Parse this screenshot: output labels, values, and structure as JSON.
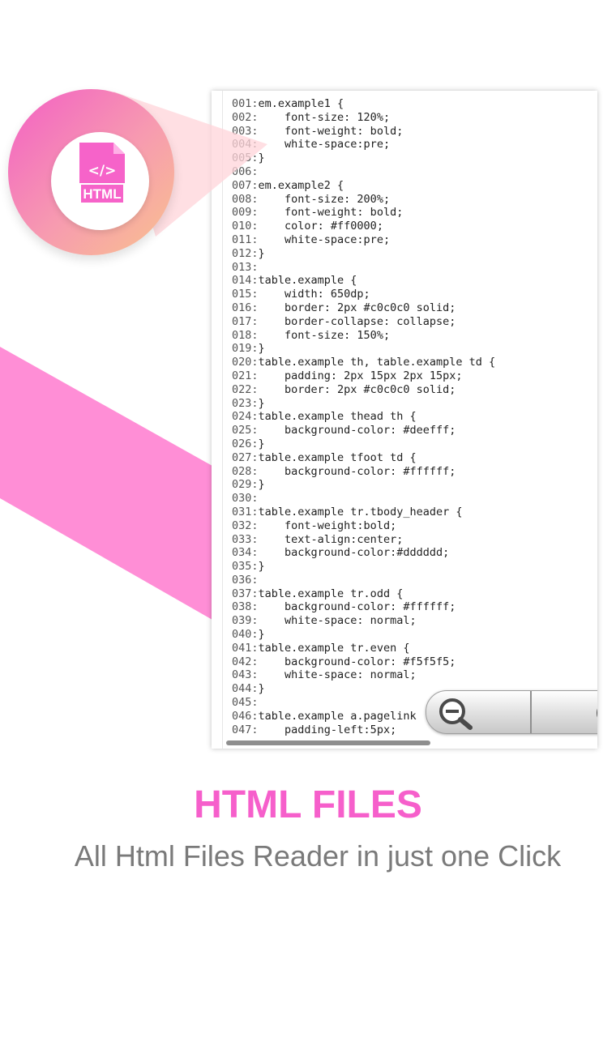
{
  "colors": {
    "accent_pink": "#f65fcb",
    "stripe_pink": "#ff8ed6",
    "subtitle_gray": "#7a7a7a"
  },
  "badge": {
    "icon": "html-file-icon",
    "code_glyph": "</>",
    "label": "HTML"
  },
  "code_lines": [
    {
      "num": "001:",
      "text": "em.example1 {"
    },
    {
      "num": "002:",
      "text": "    font-size: 120%;"
    },
    {
      "num": "003:",
      "text": "    font-weight: bold;"
    },
    {
      "num": "004:",
      "text": "    white-space:pre;"
    },
    {
      "num": "005:",
      "text": "}"
    },
    {
      "num": "006:",
      "text": ""
    },
    {
      "num": "007:",
      "text": "em.example2 {"
    },
    {
      "num": "008:",
      "text": "    font-size: 200%;"
    },
    {
      "num": "009:",
      "text": "    font-weight: bold;"
    },
    {
      "num": "010:",
      "text": "    color: #ff0000;"
    },
    {
      "num": "011:",
      "text": "    white-space:pre;"
    },
    {
      "num": "012:",
      "text": "}"
    },
    {
      "num": "013:",
      "text": ""
    },
    {
      "num": "014:",
      "text": "table.example {"
    },
    {
      "num": "015:",
      "text": "    width: 650dp;"
    },
    {
      "num": "016:",
      "text": "    border: 2px #c0c0c0 solid;"
    },
    {
      "num": "017:",
      "text": "    border-collapse: collapse;"
    },
    {
      "num": "018:",
      "text": "    font-size: 150%;"
    },
    {
      "num": "019:",
      "text": "}"
    },
    {
      "num": "020:",
      "text": "table.example th, table.example td {"
    },
    {
      "num": "021:",
      "text": "    padding: 2px 15px 2px 15px;"
    },
    {
      "num": "022:",
      "text": "    border: 2px #c0c0c0 solid;"
    },
    {
      "num": "023:",
      "text": "}"
    },
    {
      "num": "024:",
      "text": "table.example thead th {"
    },
    {
      "num": "025:",
      "text": "    background-color: #deefff;"
    },
    {
      "num": "026:",
      "text": "}"
    },
    {
      "num": "027:",
      "text": "table.example tfoot td {"
    },
    {
      "num": "028:",
      "text": "    background-color: #ffffff;"
    },
    {
      "num": "029:",
      "text": "}"
    },
    {
      "num": "030:",
      "text": ""
    },
    {
      "num": "031:",
      "text": "table.example tr.tbody_header {"
    },
    {
      "num": "032:",
      "text": "    font-weight:bold;"
    },
    {
      "num": "033:",
      "text": "    text-align:center;"
    },
    {
      "num": "034:",
      "text": "    background-color:#dddddd;"
    },
    {
      "num": "035:",
      "text": "}"
    },
    {
      "num": "036:",
      "text": ""
    },
    {
      "num": "037:",
      "text": "table.example tr.odd {"
    },
    {
      "num": "038:",
      "text": "    background-color: #ffffff;"
    },
    {
      "num": "039:",
      "text": "    white-space: normal;"
    },
    {
      "num": "040:",
      "text": "}"
    },
    {
      "num": "041:",
      "text": "table.example tr.even {"
    },
    {
      "num": "042:",
      "text": "    background-color: #f5f5f5;"
    },
    {
      "num": "043:",
      "text": "    white-space: normal;"
    },
    {
      "num": "044:",
      "text": "}"
    },
    {
      "num": "045:",
      "text": ""
    },
    {
      "num": "046:",
      "text": "table.example a.pagelink"
    },
    {
      "num": "047:",
      "text": "    padding-left:5px;"
    }
  ],
  "zoom": {
    "out_icon": "zoom-out-icon",
    "in_icon": "zoom-in-icon"
  },
  "title": "HTML FILES",
  "subtitle": "All Html Files Reader in just one Click"
}
